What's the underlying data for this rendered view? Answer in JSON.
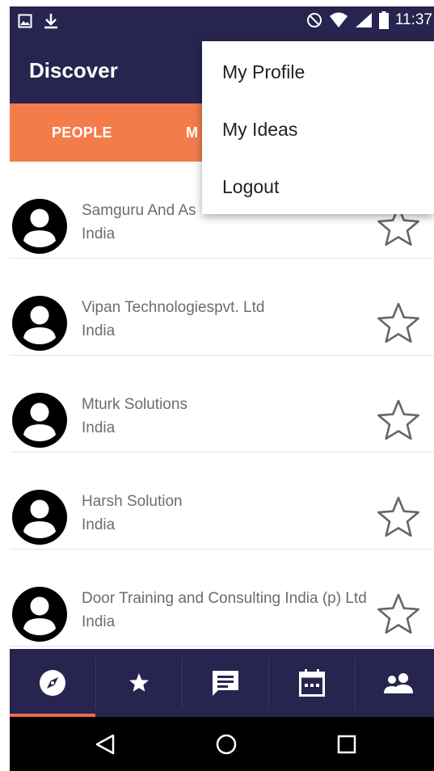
{
  "status_bar": {
    "time": "11:37",
    "icons": [
      "image-icon",
      "download-icon",
      "do-not-disturb-icon",
      "wifi-icon",
      "signal-icon",
      "battery-icon"
    ]
  },
  "app_bar": {
    "title": "Discover"
  },
  "tabs": [
    {
      "label": "PEOPLE",
      "selected": true
    },
    {
      "label": "M"
    }
  ],
  "list": {
    "items": [
      {
        "name": "Samguru And Associates",
        "visible_name": "Samguru And As",
        "country": "India"
      },
      {
        "name": "Vipan Technologiespvt. Ltd",
        "country": "India"
      },
      {
        "name": "Mturk Solutions",
        "country": "India"
      },
      {
        "name": "Harsh Solution",
        "country": "India"
      },
      {
        "name": "Door Training and Consulting India (p) Ltd",
        "country": "India"
      }
    ]
  },
  "menu": {
    "items": [
      "My Profile",
      "My Ideas",
      "Logout"
    ]
  },
  "bottom_nav": {
    "items": [
      "compass-icon",
      "star-icon",
      "chat-icon",
      "calendar-icon",
      "people-icon"
    ],
    "selected": 0
  },
  "system_nav": [
    "back-icon",
    "home-icon",
    "recents-icon"
  ],
  "colors": {
    "primary": "#27254f",
    "accent": "#f47c4b",
    "indicator": "#f06a45"
  }
}
